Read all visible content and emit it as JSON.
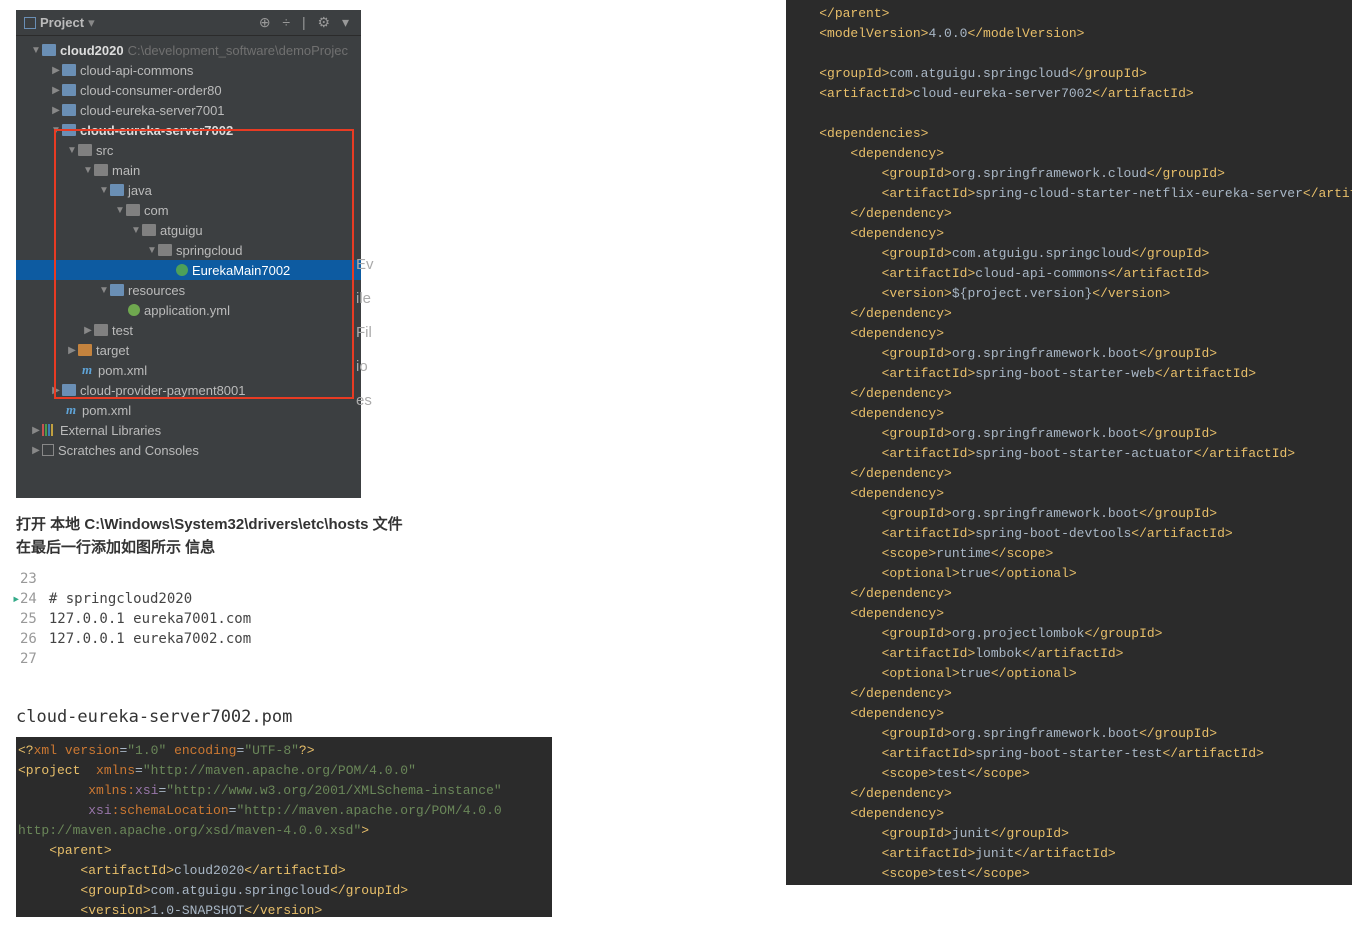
{
  "ide": {
    "header_title": "Project",
    "header_icons": "⊕  ÷  |  ⚙  ▾",
    "root": {
      "name": "cloud2020",
      "path": "C:\\development_software\\demoProjec"
    },
    "modules": [
      "cloud-api-commons",
      "cloud-consumer-order80",
      "cloud-eureka-server7001",
      "cloud-eureka-server7002",
      "cloud-provider-payment8001"
    ],
    "selected_module": {
      "name": "cloud-eureka-server7002",
      "src": "src",
      "main": "main",
      "java": "java",
      "com": "com",
      "atguigu": "atguigu",
      "springcloud": "springcloud",
      "main_class": "EurekaMain7002",
      "resources": "resources",
      "app_yml": "application.yml",
      "test": "test",
      "target": "target",
      "pom": "pom.xml"
    },
    "outer_pom": "pom.xml",
    "ext_lib": "External Libraries",
    "scratches": "Scratches and Consoles",
    "side_letters": [
      "Ev",
      "ile",
      "Fil",
      "io",
      "es"
    ]
  },
  "instruction": {
    "line1": "打开 本地  C:\\Windows\\System32\\drivers\\etc\\hosts  文件",
    "line2": "在最后一行添加如图所示  信息"
  },
  "hosts_file": {
    "lines": [
      {
        "num": "23",
        "text": ""
      },
      {
        "num": "24",
        "text": "# springcloud2020",
        "marker": true
      },
      {
        "num": "25",
        "text": "127.0.0.1 eureka7001.com"
      },
      {
        "num": "26",
        "text": "127.0.0.1 eureka7002.com"
      },
      {
        "num": "27",
        "text": ""
      }
    ]
  },
  "pom_title": "cloud-eureka-server7002.pom",
  "pom_xml": {
    "xml_decl_version": "1.0",
    "xml_decl_encoding": "UTF-8",
    "ns_default": "http://maven.apache.org/POM/4.0.0",
    "ns_xsi": "http://www.w3.org/2001/XMLSchema-instance",
    "schema_loc": "http://maven.apache.org/POM/4.0.0\nhttp://maven.apache.org/xsd/maven-4.0.0.xsd",
    "parent": {
      "artifactId": "cloud2020",
      "groupId": "com.atguigu.springcloud",
      "version": "1.0-SNAPSHOT"
    },
    "modelVersion": "4.0.0",
    "groupId": "com.atguigu.springcloud",
    "artifactId": "cloud-eureka-server7002",
    "dependencies": [
      {
        "groupId": "org.springframework.cloud",
        "artifactId": "spring-cloud-starter-netflix-eureka-server"
      },
      {
        "groupId": "com.atguigu.springcloud",
        "artifactId": "cloud-api-commons",
        "version": "${project.version}"
      },
      {
        "groupId": "org.springframework.boot",
        "artifactId": "spring-boot-starter-web"
      },
      {
        "groupId": "org.springframework.boot",
        "artifactId": "spring-boot-starter-actuator"
      },
      {
        "groupId": "org.springframework.boot",
        "artifactId": "spring-boot-devtools",
        "scope": "runtime",
        "optional": "true"
      },
      {
        "groupId": "org.projectlombok",
        "artifactId": "lombok",
        "optional": "true"
      },
      {
        "groupId": "org.springframework.boot",
        "artifactId": "spring-boot-starter-test",
        "scope": "test"
      },
      {
        "groupId": "junit",
        "artifactId": "junit",
        "scope": "test"
      }
    ]
  }
}
